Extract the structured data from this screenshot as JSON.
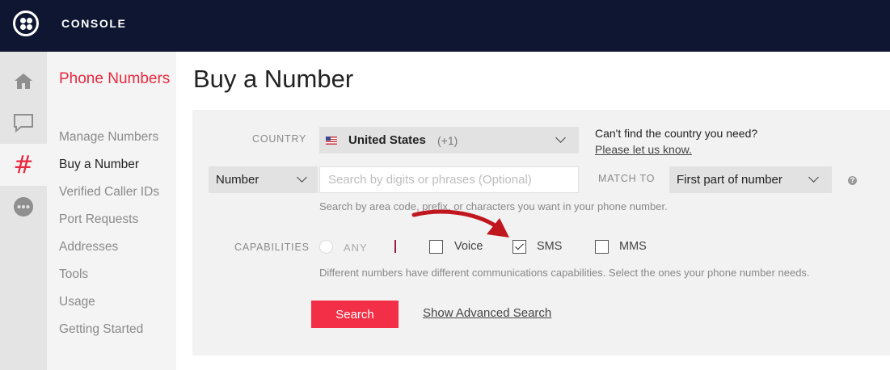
{
  "header": {
    "title": "CONSOLE"
  },
  "iconrail": {
    "items": [
      "home-icon",
      "chat-icon",
      "hash-icon",
      "more-icon"
    ],
    "active_index": 2,
    "accent_color": "#e8293f"
  },
  "sidebar": {
    "title": "Phone Numbers",
    "items": [
      {
        "label": "Manage Numbers",
        "active": false
      },
      {
        "label": "Buy a Number",
        "active": true
      },
      {
        "label": "Verified Caller IDs",
        "active": false
      },
      {
        "label": "Port Requests",
        "active": false
      },
      {
        "label": "Addresses",
        "active": false
      },
      {
        "label": "Tools",
        "active": false
      },
      {
        "label": "Usage",
        "active": false
      },
      {
        "label": "Getting Started",
        "active": false
      }
    ]
  },
  "main": {
    "title": "Buy a Number",
    "country": {
      "label": "COUNTRY",
      "value": "United States",
      "code": "(+1)"
    },
    "country_help": {
      "question": "Can't find the country you need?",
      "link": "Please let us know."
    },
    "search": {
      "type_value": "Number",
      "placeholder": "Search by digits or phrases (Optional)",
      "value": "",
      "match_label": "MATCH TO",
      "match_value": "First part of number",
      "help_icon": "question-icon",
      "hint": "Search by area code, prefix, or characters you want in your phone number."
    },
    "capabilities": {
      "label": "CAPABILITIES",
      "any_label": "ANY",
      "options": [
        {
          "label": "Voice",
          "checked": false
        },
        {
          "label": "SMS",
          "checked": true
        },
        {
          "label": "MMS",
          "checked": false
        }
      ],
      "hint": "Different numbers have different communications capabilities. Select the ones your phone number needs."
    },
    "actions": {
      "search_label": "Search",
      "advanced_label": "Show Advanced Search"
    },
    "annotation_color": "#c0171f",
    "button_color": "#f22f46"
  }
}
